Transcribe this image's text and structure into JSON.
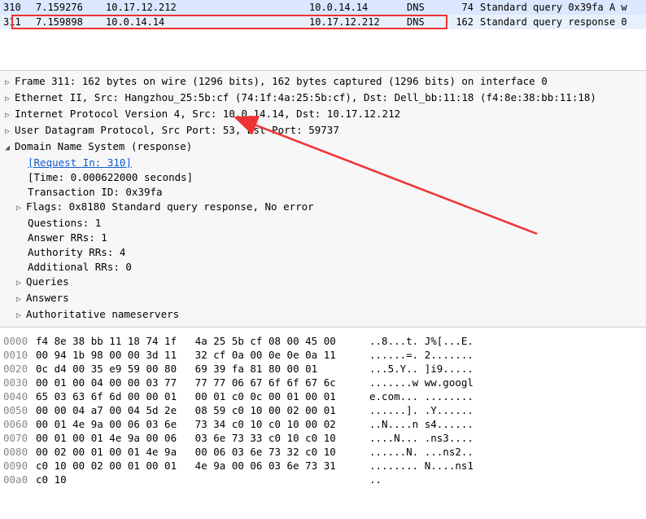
{
  "packetList": [
    {
      "no": "310",
      "time": "7.159276",
      "src": "10.17.12.212",
      "dst": "10.0.14.14",
      "proto": "DNS",
      "len": "74",
      "info": "Standard query 0x39fa A w"
    },
    {
      "no": "311",
      "time": "7.159898",
      "src": "10.0.14.14",
      "dst": "10.17.12.212",
      "proto": "DNS",
      "len": "162",
      "info": "Standard query response 0"
    }
  ],
  "details": {
    "frame": "Frame 311: 162 bytes on wire (1296 bits), 162 bytes captured (1296 bits) on interface 0",
    "eth": "Ethernet II, Src: Hangzhou_25:5b:cf (74:1f:4a:25:5b:cf), Dst: Dell_bb:11:18 (f4:8e:38:bb:11:18)",
    "ip": "Internet Protocol Version 4, Src: 10.0.14.14, Dst: 10.17.12.212",
    "udp": "User Datagram Protocol, Src Port: 53, Dst Port: 59737",
    "dns": "Domain Name System (response)",
    "dns_req": "[Request In: 310]",
    "dns_time": "[Time: 0.000622000 seconds]",
    "dns_tid": "Transaction ID: 0x39fa",
    "dns_flags": "Flags: 0x8180 Standard query response, No error",
    "dns_q": "Questions: 1",
    "dns_arr": "Answer RRs: 1",
    "dns_auth": "Authority RRs: 4",
    "dns_add": "Additional RRs: 0",
    "dns_queries": "Queries",
    "dns_answers": "Answers",
    "dns_authns": "Authoritative nameservers"
  },
  "hex": [
    {
      "off": "0000",
      "b": "f4 8e 38 bb 11 18 74 1f   4a 25 5b cf 08 00 45 00",
      "a": "..8...t. J%[...E."
    },
    {
      "off": "0010",
      "b": "00 94 1b 98 00 00 3d 11   32 cf 0a 00 0e 0e 0a 11",
      "a": "......=. 2......."
    },
    {
      "off": "0020",
      "b": "0c d4 00 35 e9 59 00 80   69 39 fa 81 80 00 01",
      "a": "...5.Y.. ]i9....."
    },
    {
      "off": "0030",
      "b": "00 01 00 04 00 00 03 77   77 77 06 67 6f 6f 67 6c",
      "a": ".......w ww.googl"
    },
    {
      "off": "0040",
      "b": "65 03 63 6f 6d 00 00 01   00 01 c0 0c 00 01 00 01",
      "a": "e.com... ........"
    },
    {
      "off": "0050",
      "b": "00 00 04 a7 00 04 5d 2e   08 59 c0 10 00 02 00 01",
      "a": "......]. .Y......"
    },
    {
      "off": "0060",
      "b": "00 01 4e 9a 00 06 03 6e   73 34 c0 10 c0 10 00 02",
      "a": "..N....n s4......"
    },
    {
      "off": "0070",
      "b": "00 01 00 01 4e 9a 00 06   03 6e 73 33 c0 10 c0 10",
      "a": "....N... .ns3...."
    },
    {
      "off": "0080",
      "b": "00 02 00 01 00 01 4e 9a   00 06 03 6e 73 32 c0 10",
      "a": "......N. ...ns2.."
    },
    {
      "off": "0090",
      "b": "c0 10 00 02 00 01 00 01   4e 9a 00 06 03 6e 73 31",
      "a": "........ N....ns1"
    },
    {
      "off": "00a0",
      "b": "c0 10",
      "a": ".."
    }
  ]
}
